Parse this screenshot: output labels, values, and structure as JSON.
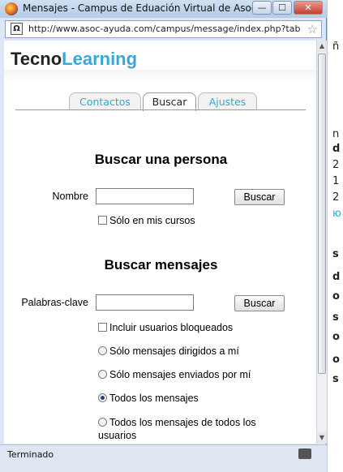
{
  "window": {
    "title": "Mensajes - Campus de Eduación Virtual de Asoc-Ay...",
    "url": "http://www.asoc-ayuda.com/campus/message/index.php?tab=",
    "status": "Terminado",
    "buttons": {
      "minimize": "—",
      "maximize": "☐",
      "close": "✕"
    },
    "site_icon": "Ω"
  },
  "logo": {
    "part1": "Tecno",
    "part2": "Learning"
  },
  "tabs": [
    {
      "label": "Contactos",
      "active": false
    },
    {
      "label": "Buscar",
      "active": true
    },
    {
      "label": "Ajustes",
      "active": false
    }
  ],
  "person_search": {
    "heading": "Buscar una persona",
    "name_label": "Nombre",
    "name_value": "",
    "button": "Buscar",
    "only_courses": "Sólo en mis cursos"
  },
  "message_search": {
    "heading": "Buscar mensajes",
    "keywords_label": "Palabras-clave",
    "keywords_value": "",
    "button": "Buscar",
    "include_blocked": "Incluir usuarios bloqueados",
    "options": [
      {
        "label": "Sólo mensajes dirigidos a mí",
        "selected": false
      },
      {
        "label": "Sólo mensajes enviados por mí",
        "selected": false
      },
      {
        "label": "Todos los mensajes",
        "selected": true
      },
      {
        "label": "Todos los mensajes de todos los usuarios",
        "selected": false
      }
    ]
  },
  "background_window": {
    "fragments": [
      "ñ",
      "n",
      "d",
      "2",
      "1",
      "2",
      "ю",
      "s",
      "d",
      "o",
      "s",
      "o",
      "o",
      "s"
    ]
  },
  "colors": {
    "accent": "#3aa6d8",
    "titlebar": "#b6cce6"
  }
}
